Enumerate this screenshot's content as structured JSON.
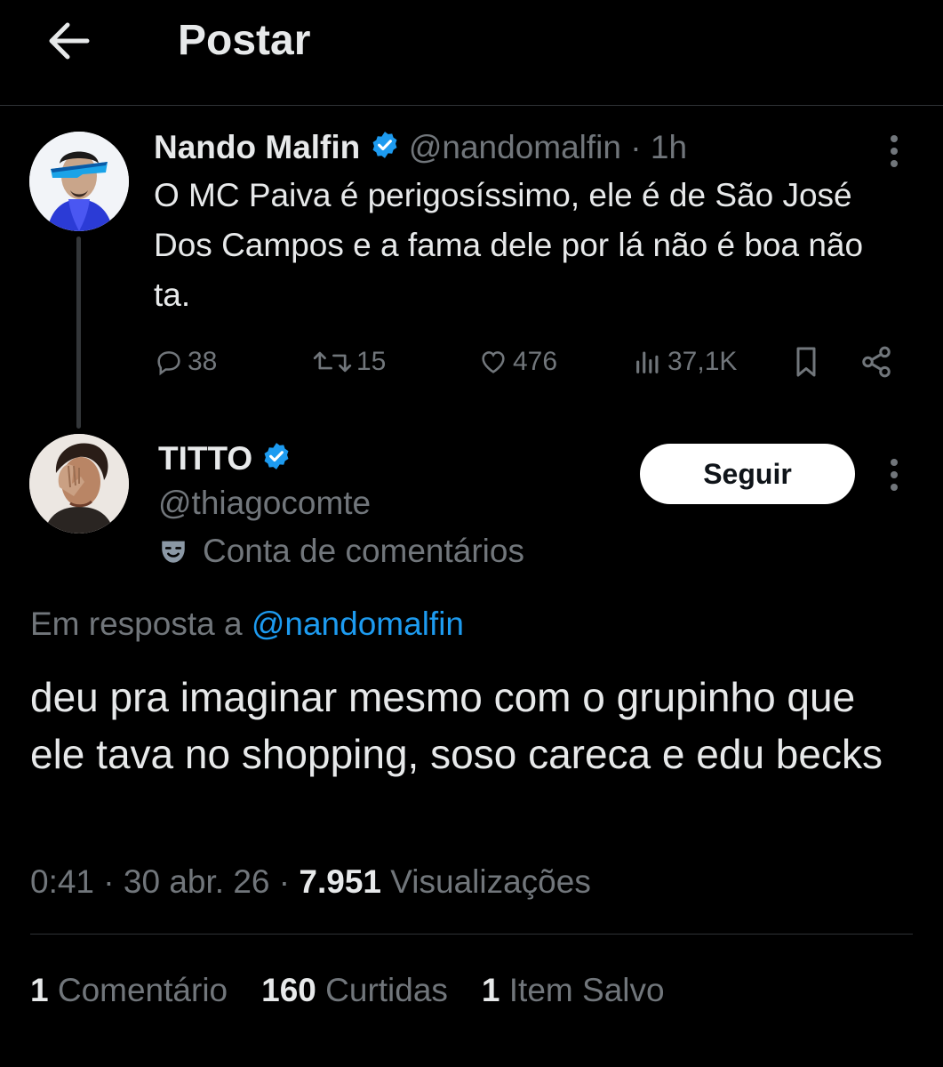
{
  "header": {
    "title": "Postar",
    "back_icon": "arrow-left-icon"
  },
  "colors": {
    "background": "#000000",
    "text": "#e7e9ea",
    "muted": "#71767b",
    "accent": "#1d9bf0",
    "divider": "#2f3336"
  },
  "original_tweet": {
    "name": "Nando Malfin",
    "handle": "@nandomalfin",
    "time": "· 1h",
    "text": "O MC Paiva é perigosíssimo, ele é de São José Dos Campos e a fama dele por lá não é boa não ta.",
    "actions": {
      "replies": "38",
      "retweets": "15",
      "likes": "476",
      "views": "37,1K"
    }
  },
  "reply_tweet": {
    "name": "TITTO",
    "handle": "@thiagocomte",
    "account_label": "Conta de comentários",
    "follow_label": "Seguir",
    "replying_prefix": "Em resposta a",
    "replying_to": "@nandomalfin",
    "text": "deu pra imaginar mesmo com o grupinho que ele tava no shopping, soso careca e edu becks",
    "time": "0:41",
    "date": "30 abr. 26",
    "views_count": "7.951",
    "views_label": "Visualizações",
    "stats": [
      {
        "count": "1",
        "label": "Comentário"
      },
      {
        "count": "160",
        "label": "Curtidas"
      },
      {
        "count": "1",
        "label": "Item Salvo"
      }
    ]
  }
}
